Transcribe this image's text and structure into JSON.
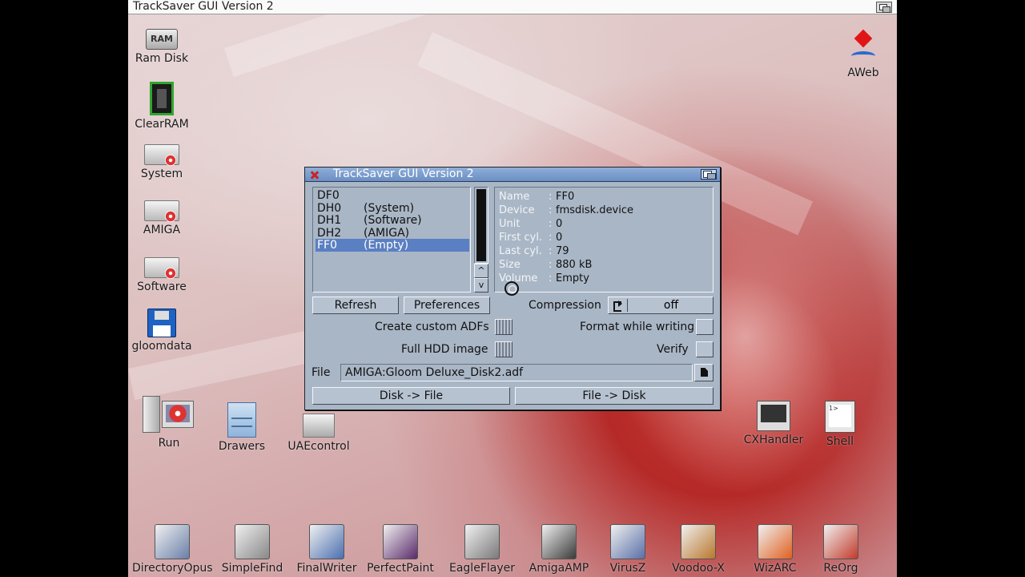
{
  "screen": {
    "title": "TrackSaver GUI Version 2"
  },
  "desktop_left": [
    {
      "label": "Ram Disk",
      "icon": "ram-disk-icon",
      "glyph": "RAM"
    },
    {
      "label": "ClearRAM",
      "icon": "memory-chip-icon"
    },
    {
      "label": "System",
      "icon": "hard-drive-icon"
    },
    {
      "label": "AMIGA",
      "icon": "hard-drive-icon"
    },
    {
      "label": "Software",
      "icon": "hard-drive-icon"
    },
    {
      "label": "gloomdata",
      "icon": "floppy-disk-icon"
    }
  ],
  "desktop_right": {
    "label": "AWeb",
    "icon": "aweb-browser-icon"
  },
  "desktop_mid": [
    {
      "label": "Run",
      "icon": "computer-icon"
    },
    {
      "label": "Drawers",
      "icon": "drawers-icon"
    },
    {
      "label": "UAEcontrol",
      "icon": "uae-drive-icon"
    },
    {
      "label": "CXHandler",
      "icon": "monitor-icon"
    },
    {
      "label": "Shell",
      "icon": "shell-icon"
    }
  ],
  "dock": [
    {
      "label": "DirectoryOpus",
      "icon": "directory-opus-icon",
      "color": "#6a7fa8"
    },
    {
      "label": "SimpleFind",
      "icon": "magnifier-icon",
      "color": "#888888"
    },
    {
      "label": "FinalWriter",
      "icon": "pen-paper-icon",
      "color": "#4a6fb0"
    },
    {
      "label": "PerfectPaint",
      "icon": "paint-icon",
      "color": "#5a2a6a"
    },
    {
      "label": "EagleFlayer",
      "icon": "music-player-icon",
      "color": "#7a7a7a"
    },
    {
      "label": "AmigaAMP",
      "icon": "amp-icon",
      "color": "#3a3a3a"
    },
    {
      "label": "VirusZ",
      "icon": "bug-icon",
      "color": "#5a6fa8"
    },
    {
      "label": "Voodoo-X",
      "icon": "box-icon",
      "color": "#b9772c"
    },
    {
      "label": "WizARC",
      "icon": "archive-star-icon",
      "color": "#e06020"
    },
    {
      "label": "ReOrg",
      "icon": "reorg-icon",
      "color": "#c23a2a"
    }
  ],
  "window": {
    "title": "TrackSaver GUI Version 2",
    "devices": [
      {
        "name": "DF0",
        "vol": ""
      },
      {
        "name": "DH0",
        "vol": "(System)"
      },
      {
        "name": "DH1",
        "vol": "(Software)"
      },
      {
        "name": "DH2",
        "vol": "(AMIGA)"
      },
      {
        "name": "FF0",
        "vol": "(Empty)"
      }
    ],
    "selected_device": "FF0",
    "info": [
      {
        "key": "Name",
        "value": "FF0"
      },
      {
        "key": "Device",
        "value": "fmsdisk.device"
      },
      {
        "key": "Unit",
        "value": "0"
      },
      {
        "key": "First cyl.",
        "value": "0"
      },
      {
        "key": "Last cyl.",
        "value": "79"
      },
      {
        "key": "Size",
        "value": "880 kB"
      },
      {
        "key": "Volume",
        "value": "Empty"
      }
    ],
    "refresh": "Refresh",
    "preferences": "Preferences",
    "compression_label": "Compression",
    "compression_value": "off",
    "create_adfs": "Create custom ADFs",
    "full_hdd": "Full HDD image",
    "format_writing": "Format while writing",
    "verify": "Verify",
    "file_label": "File",
    "file_value": "AMIGA:Gloom Deluxe_Disk2.adf",
    "disk_to_file": "Disk -> File",
    "file_to_disk": "File -> Disk",
    "scroll_up": "^",
    "scroll_down": "v"
  }
}
